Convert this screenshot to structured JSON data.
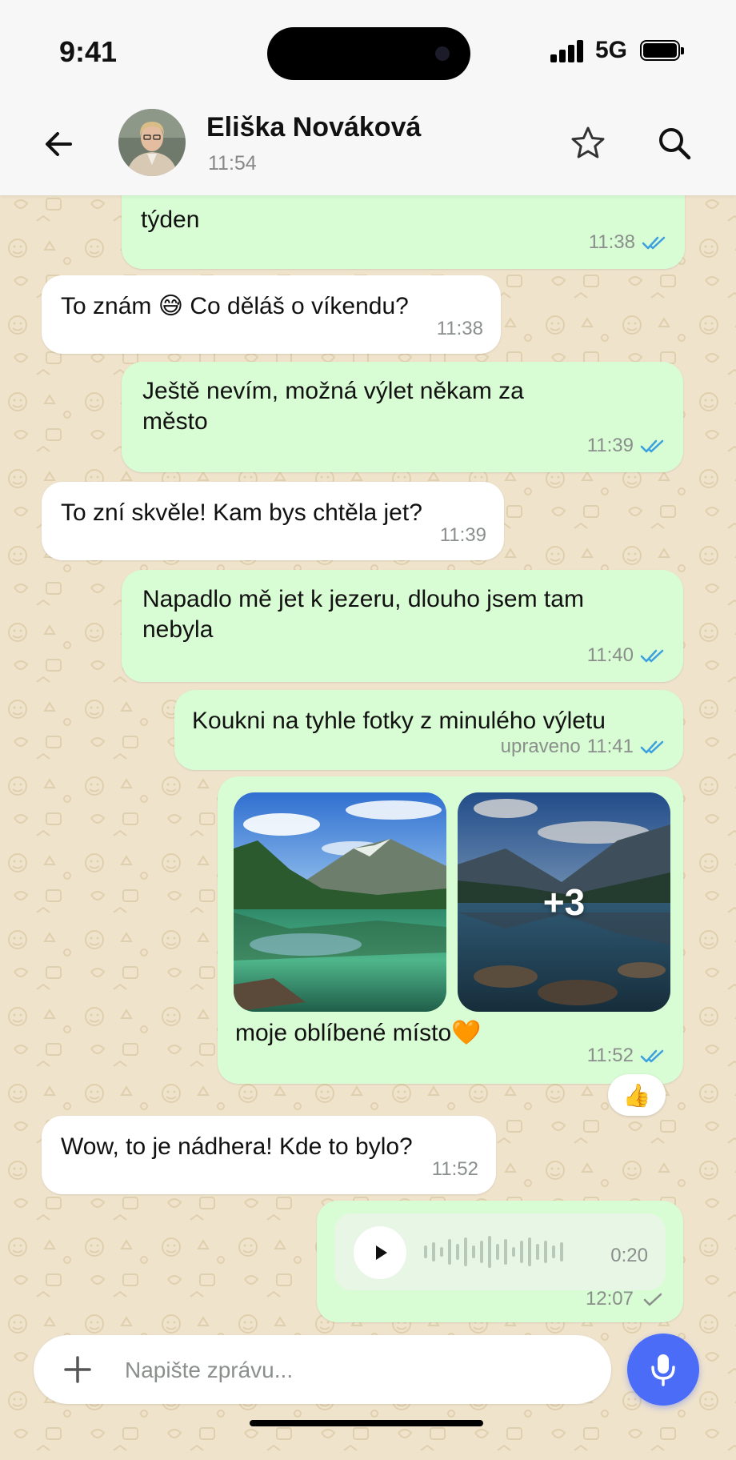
{
  "status_bar": {
    "time": "9:41",
    "network": "5G",
    "battery_level": 1.0
  },
  "header": {
    "contact_name": "Eliška Nováková",
    "contact_status": "11:54",
    "icons": [
      "back-arrow-icon",
      "avatar",
      "star-icon",
      "search-icon"
    ]
  },
  "messages": [
    {
      "direction": "out",
      "text": "týden",
      "time": "11:38",
      "read": true
    },
    {
      "direction": "in",
      "text": "To znám 😅 Co děláš o víkendu?",
      "time": "11:38"
    },
    {
      "direction": "out",
      "text": "Ještě nevím, možná výlet někam za město",
      "time": "11:39",
      "read": true
    },
    {
      "direction": "in",
      "text": "To zní skvěle! Kam bys chtěla jet?",
      "time": "11:39"
    },
    {
      "direction": "out",
      "text": "Napadlo mě jet k jezeru, dlouho jsem tam nebyla",
      "time": "11:40",
      "read": true
    },
    {
      "direction": "out",
      "text": "Koukni na tyhle fotky z minulého výletu",
      "edited_label": "upraveno",
      "time": "11:41",
      "read": true
    },
    {
      "direction": "out",
      "type": "photos",
      "more_count": "+3",
      "caption": "moje oblíbené místo🧡",
      "time": "11:52",
      "read": true,
      "reaction": "👍"
    },
    {
      "direction": "in",
      "text": "Wow, to je nádhera! Kde to bylo?",
      "time": "11:52"
    },
    {
      "direction": "out",
      "type": "voice",
      "duration": "0:20",
      "time": "12:07",
      "read": false
    }
  ],
  "composer": {
    "placeholder": "Napište zprávu..."
  },
  "colors": {
    "outgoing": "#d8fcd3",
    "incoming": "#ffffff",
    "accent": "#4a6cf7",
    "read_ticks": "#3b9fe0",
    "background": "#efe3cc"
  }
}
